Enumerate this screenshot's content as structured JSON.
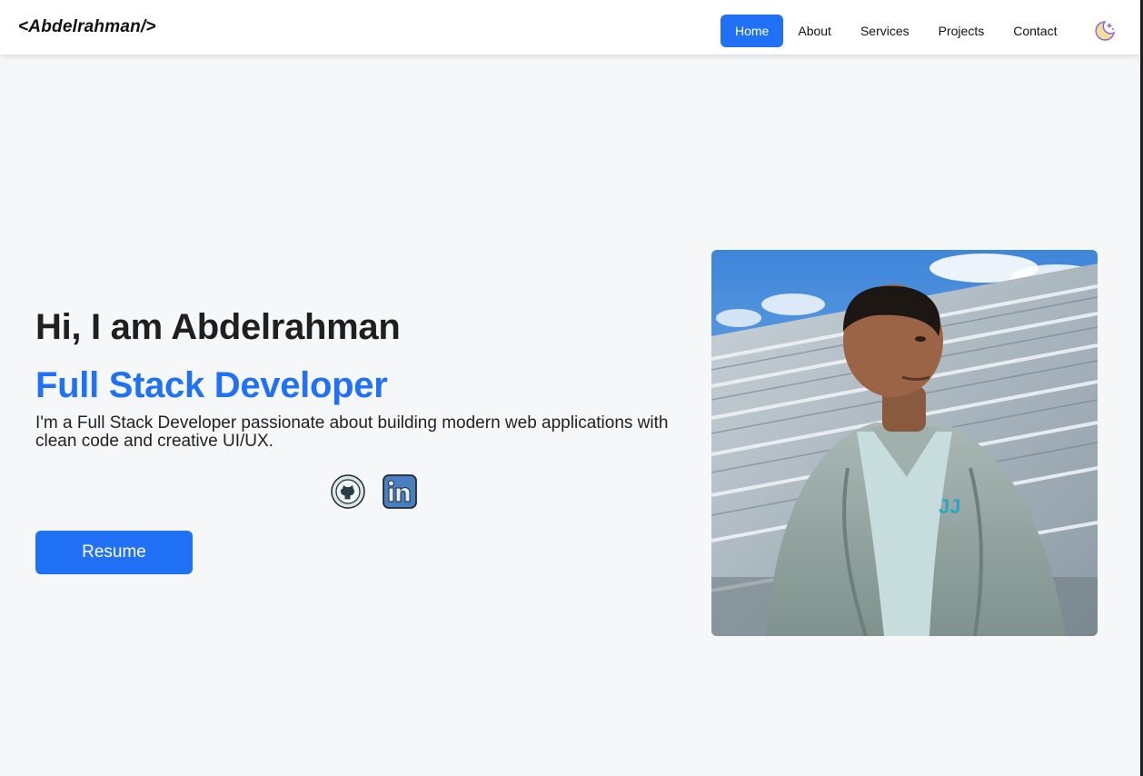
{
  "navbar": {
    "logo": "<Abdelrahman/>",
    "links": [
      {
        "label": "Home",
        "active": true
      },
      {
        "label": "About",
        "active": false
      },
      {
        "label": "Services",
        "active": false
      },
      {
        "label": "Projects",
        "active": false
      },
      {
        "label": "Contact",
        "active": false
      }
    ],
    "theme_toggle_icon": "moon-stars-icon"
  },
  "hero": {
    "title": "Hi, I am Abdelrahman",
    "role": "Full Stack Developer",
    "description": "I'm a Full Stack Developer passionate about building modern web applications with clean code and creative UI/UX.",
    "socials": [
      {
        "icon": "github-icon"
      },
      {
        "icon": "linkedin-icon"
      }
    ],
    "resume_label": "Resume",
    "photo": "profile-photo"
  },
  "colors": {
    "accent": "#2071f5",
    "background": "#f6f7f9",
    "navbar": "#ffffff",
    "text": "#1f1f1f"
  }
}
